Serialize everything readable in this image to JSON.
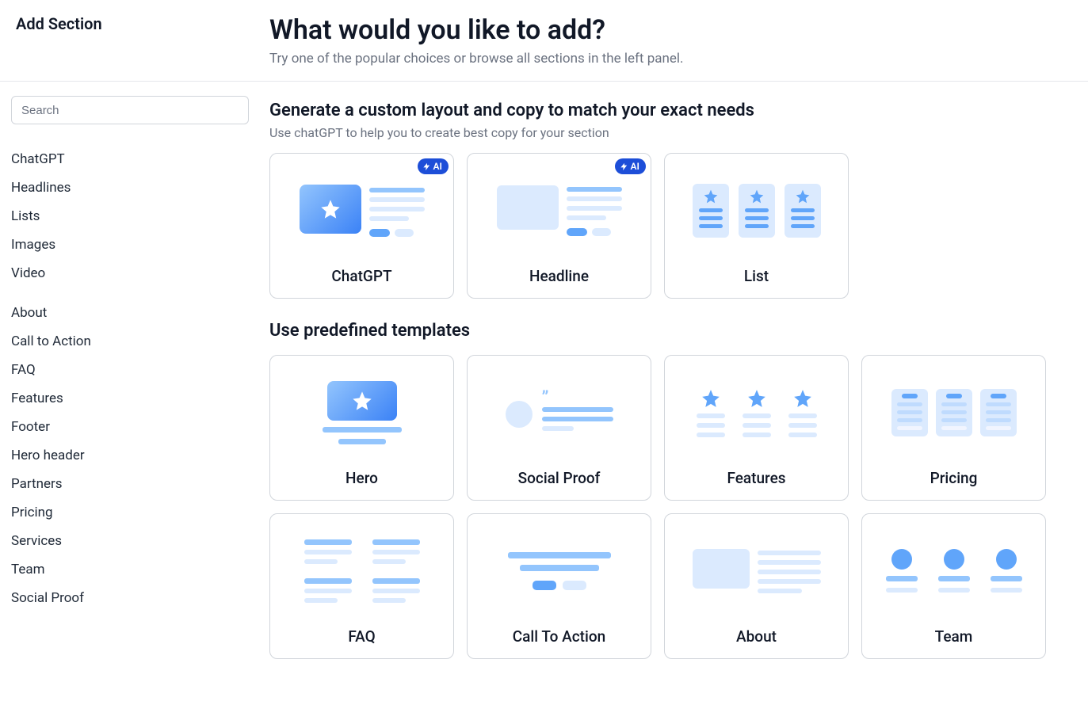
{
  "header": {
    "sidebar_title": "Add Section",
    "title": "What would you like to add?",
    "subtitle": "Try one of the popular choices or browse all sections in the left panel."
  },
  "sidebar": {
    "search_placeholder": "Search",
    "group1": [
      "ChatGPT",
      "Headlines",
      "Lists",
      "Images",
      "Video"
    ],
    "group2": [
      "About",
      "Call to Action",
      "FAQ",
      "Features",
      "Footer",
      "Hero header",
      "Partners",
      "Pricing",
      "Services",
      "Team",
      "Social Proof"
    ]
  },
  "custom_section": {
    "title": "Generate a custom layout and copy to match your exact needs",
    "subtitle": "Use chatGPT to help you to create best copy for your section",
    "ai_badge": "AI",
    "cards": [
      {
        "label": "ChatGPT",
        "ai": true
      },
      {
        "label": "Headline",
        "ai": true
      },
      {
        "label": "List",
        "ai": false
      }
    ]
  },
  "templates_section": {
    "title": "Use predefined templates",
    "cards": [
      {
        "label": "Hero"
      },
      {
        "label": "Social Proof"
      },
      {
        "label": "Features"
      },
      {
        "label": "Pricing"
      },
      {
        "label": "FAQ"
      },
      {
        "label": "Call To Action"
      },
      {
        "label": "About"
      },
      {
        "label": "Team"
      }
    ]
  }
}
